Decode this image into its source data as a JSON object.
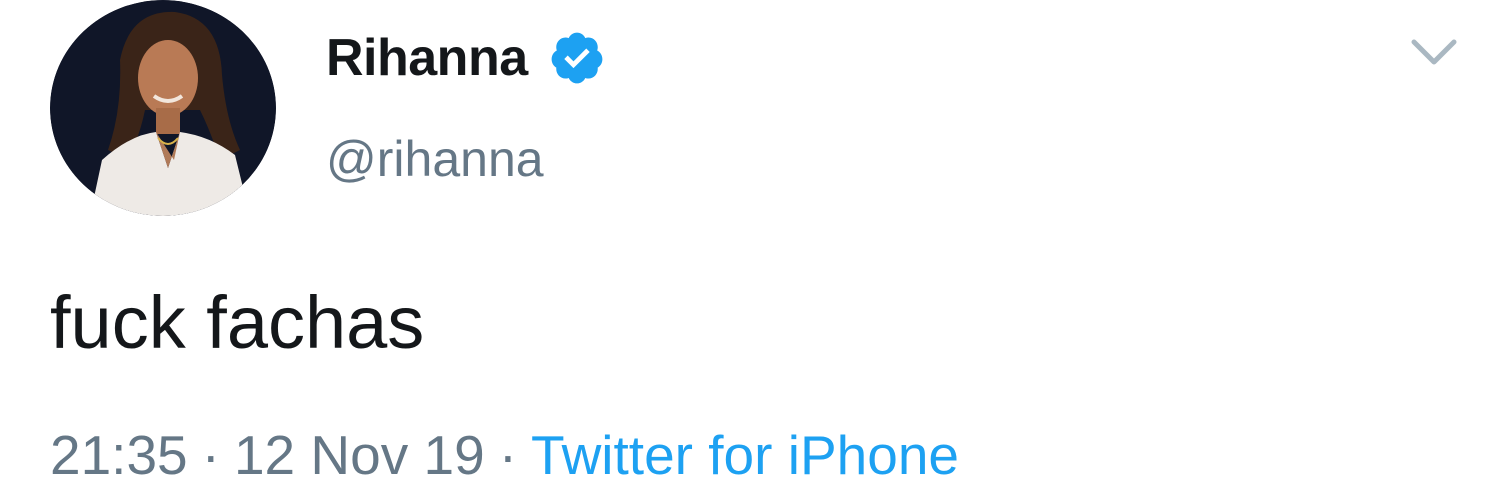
{
  "tweet": {
    "author": {
      "display_name": "Rihanna",
      "handle": "@rihanna",
      "verified": true,
      "avatar_icon": "profile-photo"
    },
    "text": "fuck fachas",
    "time": "21:35",
    "date": "12 Nov 19",
    "separator": "·",
    "source": "Twitter for iPhone",
    "menu_icon": "chevron-down-icon"
  },
  "colors": {
    "primary_text": "#14171a",
    "secondary_text": "#657786",
    "link": "#1da1f2",
    "verified_badge": "#1da1f2",
    "chevron": "#aab8c2"
  }
}
